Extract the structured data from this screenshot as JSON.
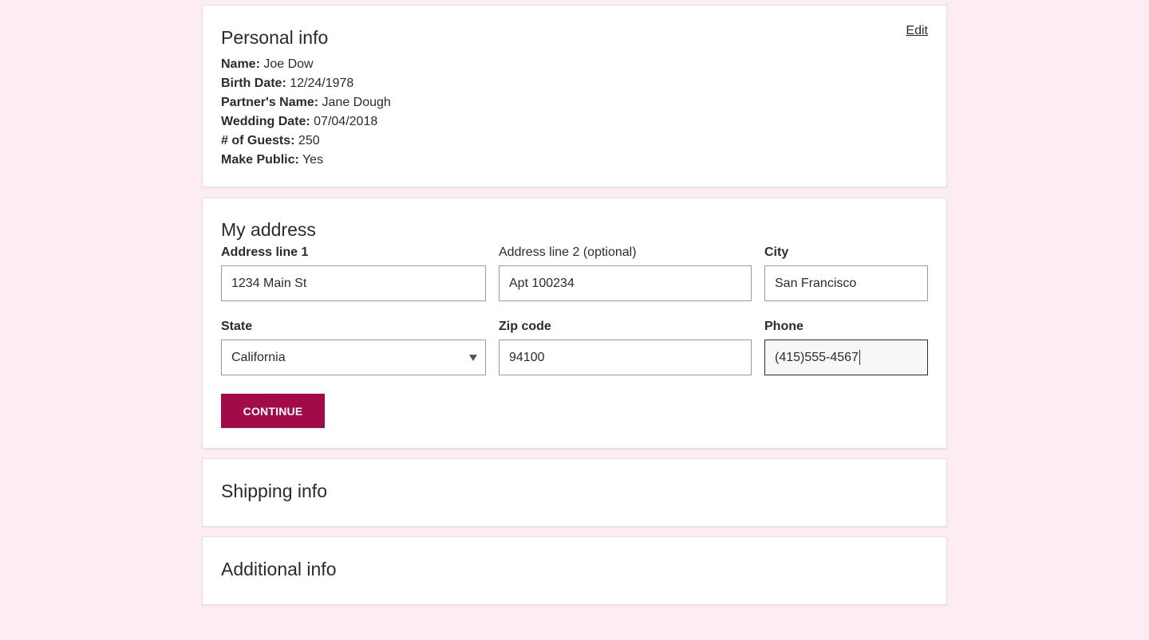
{
  "personal": {
    "title": "Personal info",
    "edit_label": "Edit",
    "rows": [
      {
        "label": "Name:",
        "value": "Joe Dow"
      },
      {
        "label": "Birth Date:",
        "value": "12/24/1978"
      },
      {
        "label": "Partner's Name:",
        "value": "Jane Dough"
      },
      {
        "label": "Wedding Date:",
        "value": "07/04/2018"
      },
      {
        "label": "# of Guests:",
        "value": "250"
      },
      {
        "label": "Make Public:",
        "value": "Yes"
      }
    ]
  },
  "address": {
    "title": "My address",
    "address1": {
      "label": "Address line 1",
      "value": "1234 Main St"
    },
    "address2": {
      "label": "Address line 2 (optional)",
      "value": "Apt 100234"
    },
    "city": {
      "label": "City",
      "value": "San Francisco"
    },
    "state": {
      "label": "State",
      "value": "California"
    },
    "zip": {
      "label": "Zip code",
      "value": "94100"
    },
    "phone": {
      "label": "Phone",
      "value": "(415)555-4567"
    },
    "continue_label": "CONTINUE"
  },
  "shipping": {
    "title": "Shipping info"
  },
  "additional": {
    "title": "Additional info"
  },
  "colors": {
    "page_background": "#fdecf1",
    "accent": "#a10c48"
  }
}
